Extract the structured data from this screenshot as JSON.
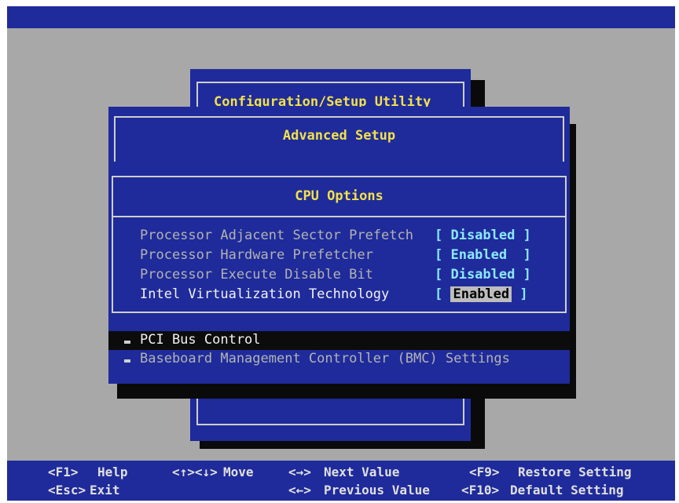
{
  "back_window": {
    "title": "Configuration/Setup Utility"
  },
  "advanced": {
    "title": "Advanced Setup"
  },
  "cpu_options": {
    "title": "CPU Options",
    "items": [
      {
        "label": "Processor Adjacent Sector Prefetch",
        "value": "[ Disabled ]"
      },
      {
        "label": "Processor Hardware Prefetcher",
        "value": "[ Enabled  ]"
      },
      {
        "label": "Processor Execute Disable Bit",
        "value": "[ Disabled ]"
      },
      {
        "label": "Intel Virtualization Technology",
        "value_open": "[ ",
        "value_selected": "Enabled",
        "value_close": " ]"
      }
    ]
  },
  "menu": [
    {
      "label": "PCI Bus Control"
    },
    {
      "label": "Baseboard Management Controller (BMC) Settings"
    }
  ],
  "footer": {
    "row1": [
      {
        "key": "<F1>",
        "label": "Help"
      },
      {
        "key": "<↑><↓>",
        "label": "Move"
      },
      {
        "key": "<→>",
        "label": "Next Value"
      },
      {
        "key": "<F9>",
        "label": "Restore Setting"
      }
    ],
    "row2": [
      {
        "key": "<Esc>",
        "label": "Exit"
      },
      {
        "key": "<←>",
        "label": "Previous Value"
      },
      {
        "key": "<F10>",
        "label": "Default Setting"
      }
    ]
  },
  "colors": {
    "panel_blue": "#1f2b9a",
    "title_yellow": "#f2e14a",
    "value_cyan": "#8ce8ff",
    "background_gray": "#a8a8a8"
  }
}
